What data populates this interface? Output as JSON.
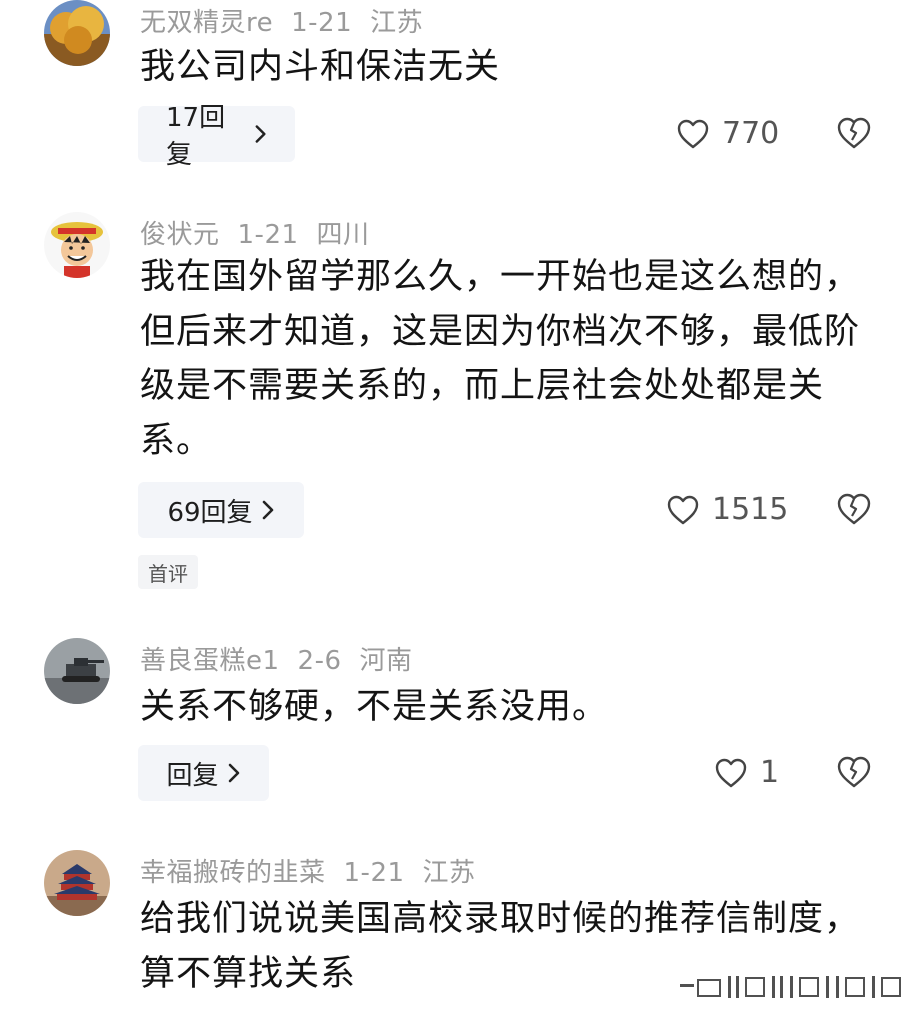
{
  "comments": [
    {
      "username": "无双精灵re",
      "date": "1-21",
      "location": "江苏",
      "text": "我公司内斗和保洁无关",
      "reply_label": "17回复",
      "likes": "770",
      "badge": ""
    },
    {
      "username": "俊状元",
      "date": "1-21",
      "location": "四川",
      "text": "我在国外留学那么久，一开始也是这么想的，但后来才知道，这是因为你档次不够，最低阶级是不需要关系的，而上层社会处处都是关系。",
      "reply_label": "69回复",
      "likes": "1515",
      "badge": "首评"
    },
    {
      "username": "善良蛋糕e1",
      "date": "2-6",
      "location": "河南",
      "text": "关系不够硬，不是关系没用。",
      "reply_label": "回复",
      "likes": "1",
      "badge": ""
    },
    {
      "username": "幸福搬砖的韭菜",
      "date": "1-21",
      "location": "江苏",
      "text": "给我们说说美国高校录取时候的推荐信制度，算不算找关系",
      "reply_label": "",
      "likes": "",
      "badge": ""
    }
  ],
  "icons": {
    "like": "heart-outline-icon",
    "dislike": "broken-heart-icon",
    "reply_chevron": "chevron-right-icon"
  },
  "colors": {
    "meta_text": "#9a9a9a",
    "reply_bg": "#f3f5f9",
    "body_text": "#141414"
  }
}
